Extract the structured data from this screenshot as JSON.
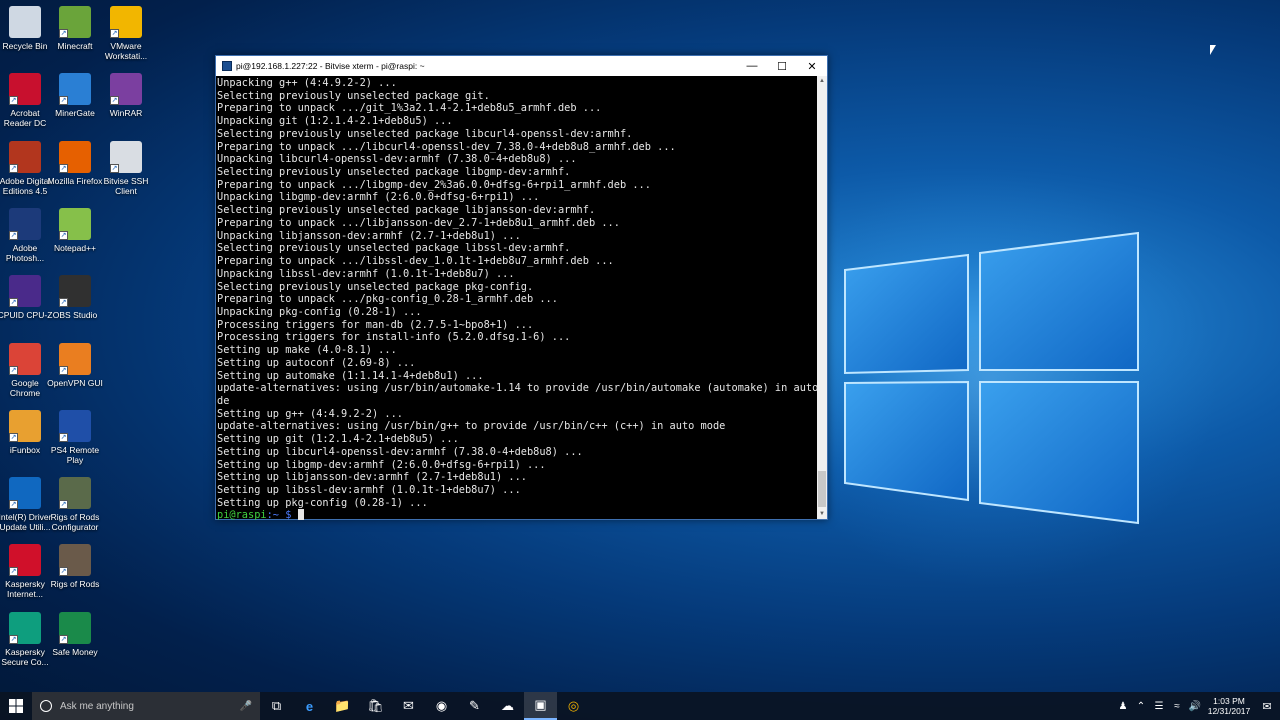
{
  "desktop": {
    "icons": [
      {
        "label": "Recycle Bin",
        "icon": "recycle-bin-icon",
        "color": "#cfd8e3"
      },
      {
        "label": "Minecraft",
        "icon": "minecraft-icon",
        "color": "#6aa43a"
      },
      {
        "label": "VMware Workstati...",
        "icon": "vmware-icon",
        "color": "#f2b600"
      },
      {
        "label": "Acrobat Reader DC",
        "icon": "acrobat-icon",
        "color": "#c8102e"
      },
      {
        "label": "MinerGate",
        "icon": "minergate-icon",
        "color": "#2a7fd4"
      },
      {
        "label": "WinRAR",
        "icon": "winrar-icon",
        "color": "#7b3fa0"
      },
      {
        "label": "Adobe Digital Editions 4.5",
        "icon": "adobe-digital-editions-icon",
        "color": "#b2361e"
      },
      {
        "label": "Mozilla Firefox",
        "icon": "firefox-icon",
        "color": "#e66000"
      },
      {
        "label": "Bitvise SSH Client",
        "icon": "bitvise-icon",
        "color": "#d9dde3"
      },
      {
        "label": "Adobe Photosh...",
        "icon": "photoshop-icon",
        "color": "#1c3a7a"
      },
      {
        "label": "Notepad++",
        "icon": "notepad-plus-plus-icon",
        "color": "#86c04a"
      },
      {
        "label": "CPUID CPU-Z",
        "icon": "cpuz-icon",
        "color": "#4a2a8a"
      },
      {
        "label": "OBS Studio",
        "icon": "obs-icon",
        "color": "#303030"
      },
      {
        "label": "Google Chrome",
        "icon": "chrome-icon",
        "color": "#db4437"
      },
      {
        "label": "OpenVPN GUI",
        "icon": "openvpn-icon",
        "color": "#ea7e20"
      },
      {
        "label": "iFunbox",
        "icon": "ifunbox-icon",
        "color": "#e8a030"
      },
      {
        "label": "PS4 Remote Play",
        "icon": "ps4-remote-play-icon",
        "color": "#1f4fa8"
      },
      {
        "label": "Intel(R) Driver Update Utili...",
        "icon": "intel-icon",
        "color": "#1068c0"
      },
      {
        "label": "Rigs of Rods Configurator",
        "icon": "rigs-of-rods-icon",
        "color": "#5a6a4a"
      },
      {
        "label": "Kaspersky Internet...",
        "icon": "kaspersky-icon",
        "color": "#d0102a"
      },
      {
        "label": "Rigs of Rods",
        "icon": "rigs-of-rods-icon",
        "color": "#6a5a4a"
      },
      {
        "label": "Kaspersky Secure Co...",
        "icon": "kaspersky-secure-icon",
        "color": "#0e9e7e"
      },
      {
        "label": "Safe Money",
        "icon": "safe-money-icon",
        "color": "#1a8a4a"
      }
    ]
  },
  "terminal": {
    "title": "pi@192.168.1.227:22 - Bitvise xterm - pi@raspi: ~",
    "lines": [
      "Unpacking g++ (4:4.9.2-2) ...",
      "Selecting previously unselected package git.",
      "Preparing to unpack .../git_1%3a2.1.4-2.1+deb8u5_armhf.deb ...",
      "Unpacking git (1:2.1.4-2.1+deb8u5) ...",
      "Selecting previously unselected package libcurl4-openssl-dev:armhf.",
      "Preparing to unpack .../libcurl4-openssl-dev_7.38.0-4+deb8u8_armhf.deb ...",
      "Unpacking libcurl4-openssl-dev:armhf (7.38.0-4+deb8u8) ...",
      "Selecting previously unselected package libgmp-dev:armhf.",
      "Preparing to unpack .../libgmp-dev_2%3a6.0.0+dfsg-6+rpi1_armhf.deb ...",
      "Unpacking libgmp-dev:armhf (2:6.0.0+dfsg-6+rpi1) ...",
      "Selecting previously unselected package libjansson-dev:armhf.",
      "Preparing to unpack .../libjansson-dev_2.7-1+deb8u1_armhf.deb ...",
      "Unpacking libjansson-dev:armhf (2.7-1+deb8u1) ...",
      "Selecting previously unselected package libssl-dev:armhf.",
      "Preparing to unpack .../libssl-dev_1.0.1t-1+deb8u7_armhf.deb ...",
      "Unpacking libssl-dev:armhf (1.0.1t-1+deb8u7) ...",
      "Selecting previously unselected package pkg-config.",
      "Preparing to unpack .../pkg-config_0.28-1_armhf.deb ...",
      "Unpacking pkg-config (0.28-1) ...",
      "Processing triggers for man-db (2.7.5-1~bpo8+1) ...",
      "Processing triggers for install-info (5.2.0.dfsg.1-6) ...",
      "Setting up make (4.0-8.1) ...",
      "Setting up autoconf (2.69-8) ...",
      "Setting up automake (1:1.14.1-4+deb8u1) ...",
      "update-alternatives: using /usr/bin/automake-1.14 to provide /usr/bin/automake (automake) in auto mo",
      "de",
      "Setting up g++ (4:4.9.2-2) ...",
      "update-alternatives: using /usr/bin/g++ to provide /usr/bin/c++ (c++) in auto mode",
      "Setting up git (1:2.1.4-2.1+deb8u5) ...",
      "Setting up libcurl4-openssl-dev:armhf (7.38.0-4+deb8u8) ...",
      "Setting up libgmp-dev:armhf (2:6.0.0+dfsg-6+rpi1) ...",
      "Setting up libjansson-dev:armhf (2.7-1+deb8u1) ...",
      "Setting up libssl-dev:armhf (1.0.1t-1+deb8u7) ...",
      "Setting up pkg-config (0.28-1) ..."
    ],
    "prompt_user": "pi@raspi",
    "prompt_path": ":~ $",
    "colors": {
      "user": "#3fd13f",
      "path": "#4d7bff",
      "text": "#e6e6e6"
    }
  },
  "taskbar": {
    "search_placeholder": "Ask me anything",
    "time": "1:03 PM",
    "date": "12/31/2017",
    "pinned": [
      "task-view-icon",
      "edge-icon",
      "file-explorer-icon",
      "store-icon",
      "mail-icon",
      "minergate-icon",
      "notepad-icon",
      "bitvise-icon",
      "bitvise-xterm-icon",
      "chrome-icon"
    ]
  }
}
